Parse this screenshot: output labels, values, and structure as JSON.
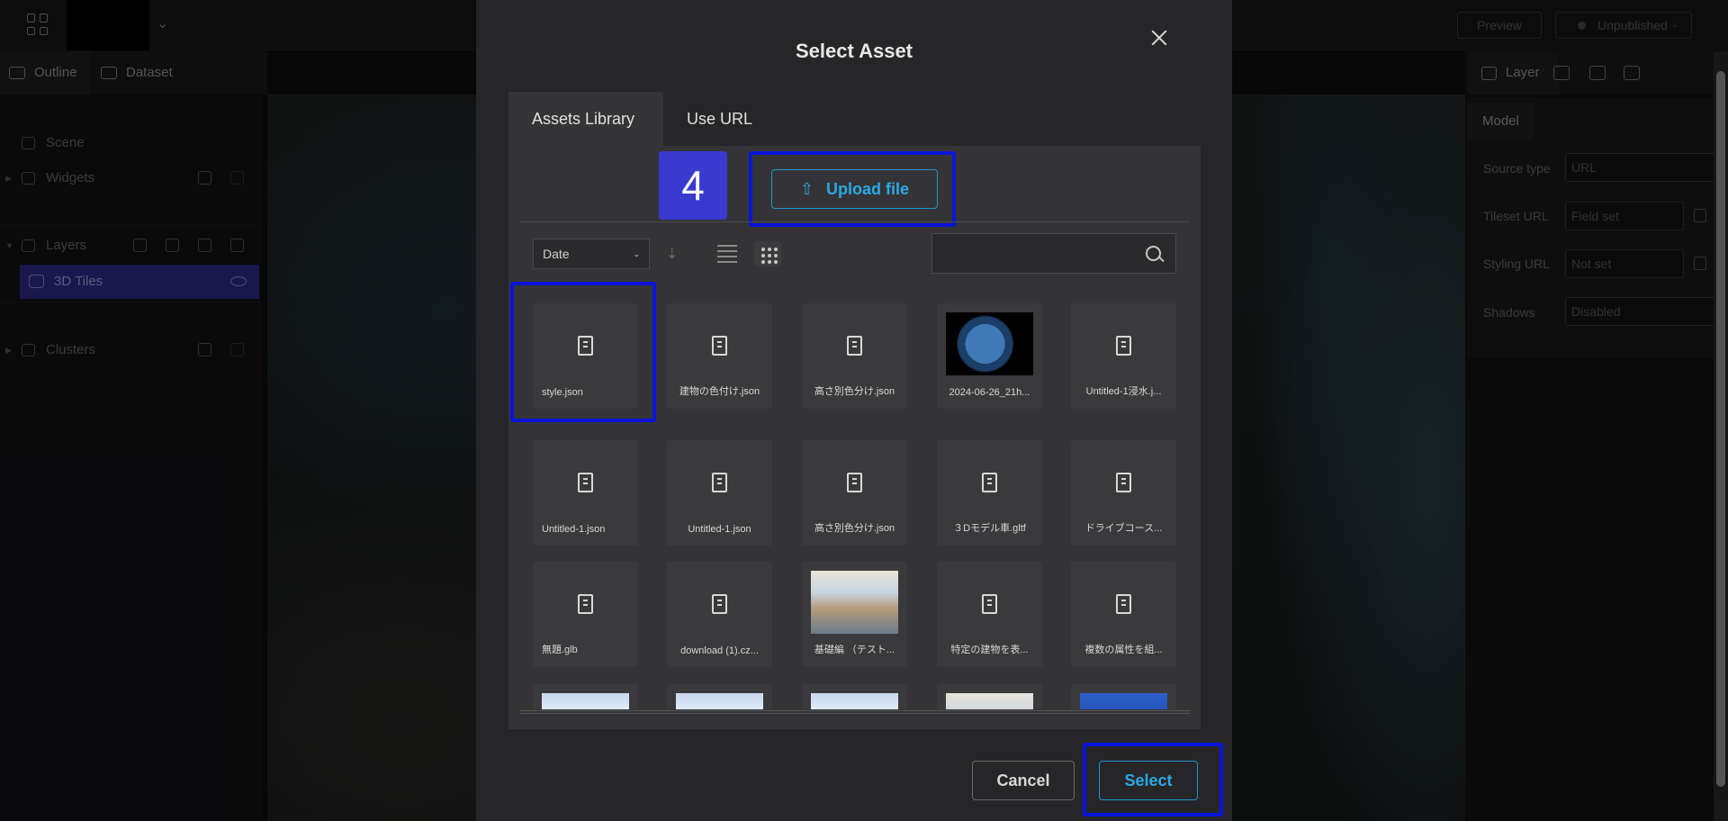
{
  "topbar": {
    "preview_label": "Preview",
    "publish_label": "Unpublished"
  },
  "left_panel": {
    "tabs": [
      "Outline",
      "Dataset"
    ],
    "tree": {
      "scene": "Scene",
      "widgets": "Widgets",
      "layers": "Layers",
      "selected_layer": "3D Tiles",
      "clusters": "Clusters"
    }
  },
  "right_panel": {
    "tab_layer": "Layer",
    "model_tab": "Model",
    "props": [
      {
        "label": "Source type",
        "value": "URL"
      },
      {
        "label": "Tileset URL",
        "value": "Field set"
      },
      {
        "label": "Styling URL",
        "value": "Not set"
      },
      {
        "label": "Shadows",
        "value": "Disabled"
      }
    ]
  },
  "modal": {
    "title": "Select Asset",
    "tabs": [
      "Assets Library",
      "Use URL"
    ],
    "step_badge": "4",
    "upload_label": "Upload file",
    "sort_value": "Date",
    "search_placeholder": "",
    "assets": [
      {
        "name": "style.json",
        "thumb": "file"
      },
      {
        "name": "建物の色付け.json",
        "thumb": "file"
      },
      {
        "name": "高さ別色分け.json",
        "thumb": "file"
      },
      {
        "name": "2024-06-26_21h...",
        "thumb": "globe"
      },
      {
        "name": "Untitled-1浸水.j...",
        "thumb": "file"
      },
      {
        "name": "Untitled-1.json",
        "thumb": "file"
      },
      {
        "name": "Untitled-1.json",
        "thumb": "file"
      },
      {
        "name": "高さ別色分け.json",
        "thumb": "file"
      },
      {
        "name": "３Dモデル車.gltf",
        "thumb": "file"
      },
      {
        "name": "ドライブコース...",
        "thumb": "file"
      },
      {
        "name": "無題.glb",
        "thumb": "file"
      },
      {
        "name": "download (1).cz...",
        "thumb": "file"
      },
      {
        "name": "基礎編 （テスト...",
        "thumb": "poster"
      },
      {
        "name": "特定の建物を表...",
        "thumb": "file"
      },
      {
        "name": "複数の属性を組...",
        "thumb": "file"
      },
      {
        "name": "",
        "thumb": "sky"
      },
      {
        "name": "",
        "thumb": "sky"
      },
      {
        "name": "",
        "thumb": "sky"
      },
      {
        "name": "",
        "thumb": "poster"
      },
      {
        "name": "",
        "thumb": "blue"
      }
    ],
    "cancel_label": "Cancel",
    "select_label": "Select"
  }
}
